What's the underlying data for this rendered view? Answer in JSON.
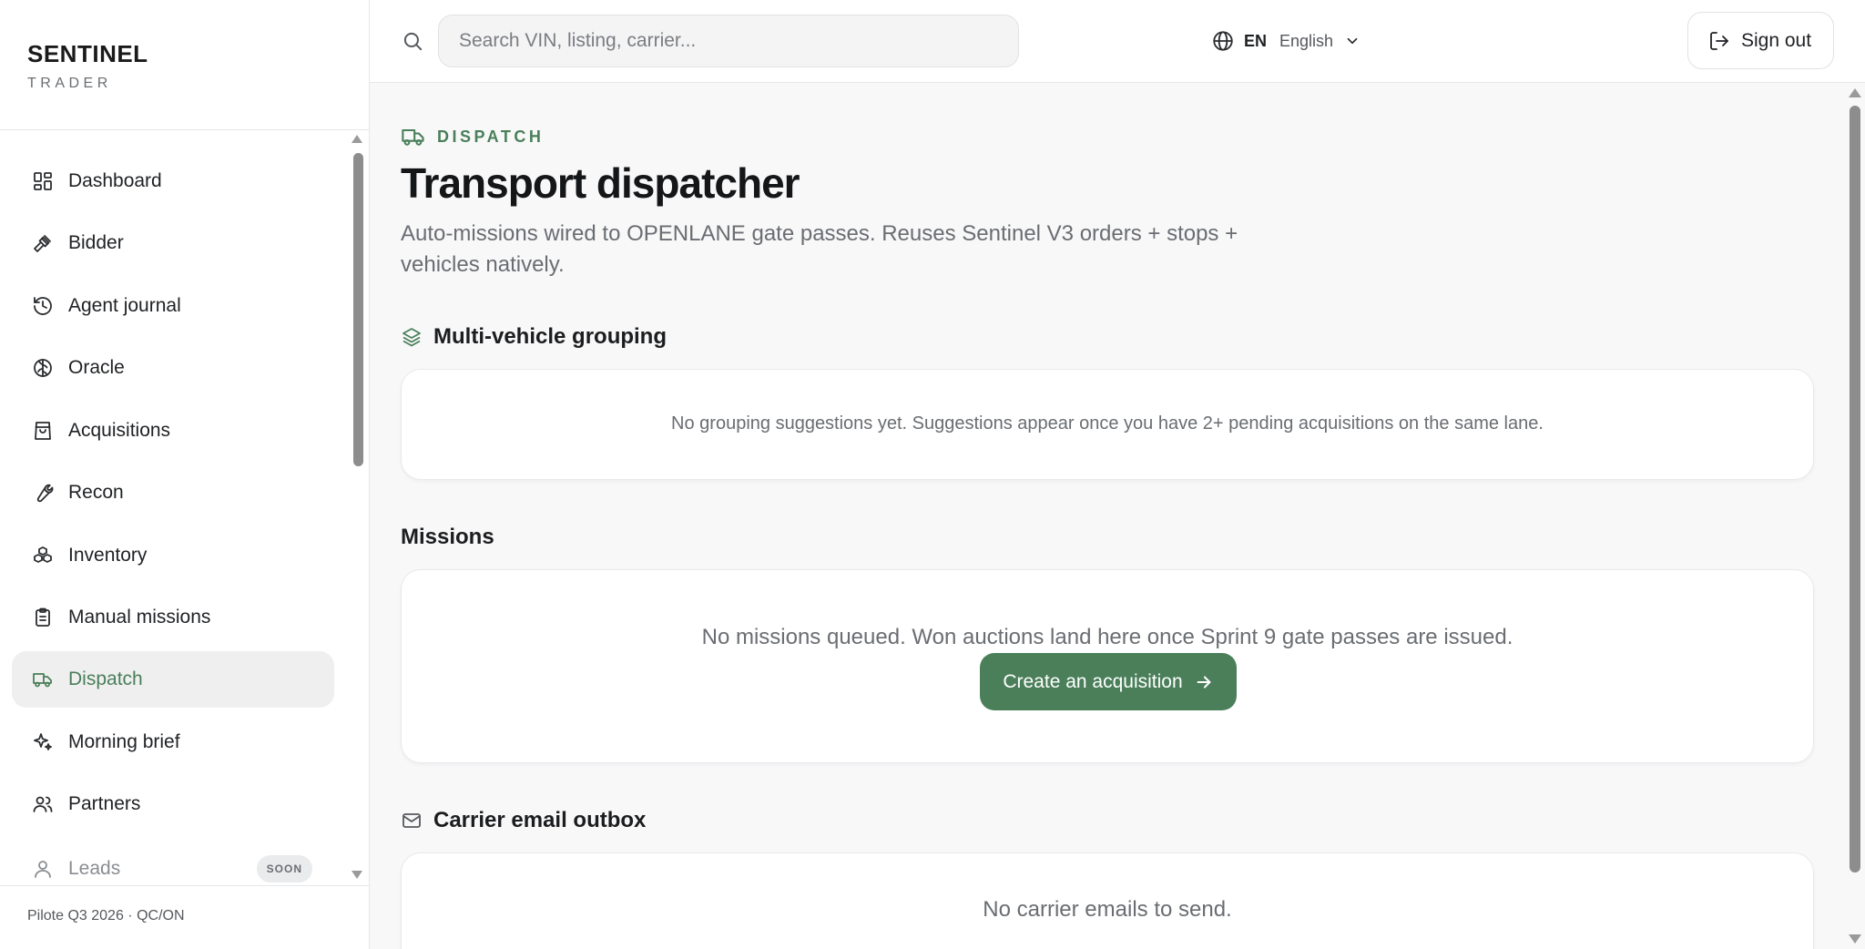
{
  "brand": {
    "name": "SENTINEL",
    "subtitle": "TRADER"
  },
  "sidebar": {
    "items": [
      {
        "label": "Dashboard",
        "icon": "dashboard-icon"
      },
      {
        "label": "Bidder",
        "icon": "gavel-icon"
      },
      {
        "label": "Agent journal",
        "icon": "history-icon"
      },
      {
        "label": "Oracle",
        "icon": "brain-icon"
      },
      {
        "label": "Acquisitions",
        "icon": "shopping-bag-icon"
      },
      {
        "label": "Recon",
        "icon": "wrench-icon"
      },
      {
        "label": "Inventory",
        "icon": "boxes-icon"
      },
      {
        "label": "Manual missions",
        "icon": "clipboard-icon"
      },
      {
        "label": "Dispatch",
        "icon": "truck-icon",
        "active": true
      },
      {
        "label": "Morning brief",
        "icon": "sparkles-icon"
      },
      {
        "label": "Partners",
        "icon": "users-icon"
      },
      {
        "label": "Leads",
        "icon": "user-icon",
        "badge": "SOON",
        "disabled": true
      }
    ],
    "footer": "Pilote Q3 2026 · QC/ON"
  },
  "topbar": {
    "search_placeholder": "Search VIN, listing, carrier...",
    "language_code": "EN",
    "language_name": "English",
    "signout_label": "Sign out"
  },
  "page": {
    "eyebrow": "DISPATCH",
    "title": "Transport dispatcher",
    "description": "Auto-missions wired to OPENLANE gate passes. Reuses Sentinel V3 orders + stops + vehicles natively."
  },
  "sections": {
    "grouping": {
      "title": "Multi-vehicle grouping",
      "empty": "No grouping suggestions yet. Suggestions appear once you have 2+ pending acquisitions on the same lane."
    },
    "missions": {
      "title": "Missions",
      "empty": "No missions queued. Won auctions land here once Sprint 9 gate passes are issued.",
      "cta": "Create an acquisition"
    },
    "outbox": {
      "title": "Carrier email outbox",
      "empty": "No carrier emails to send."
    }
  },
  "colors": {
    "accent": "#4a7f5a",
    "active_bg": "#efefef",
    "page_bg": "#f8f8f9"
  }
}
